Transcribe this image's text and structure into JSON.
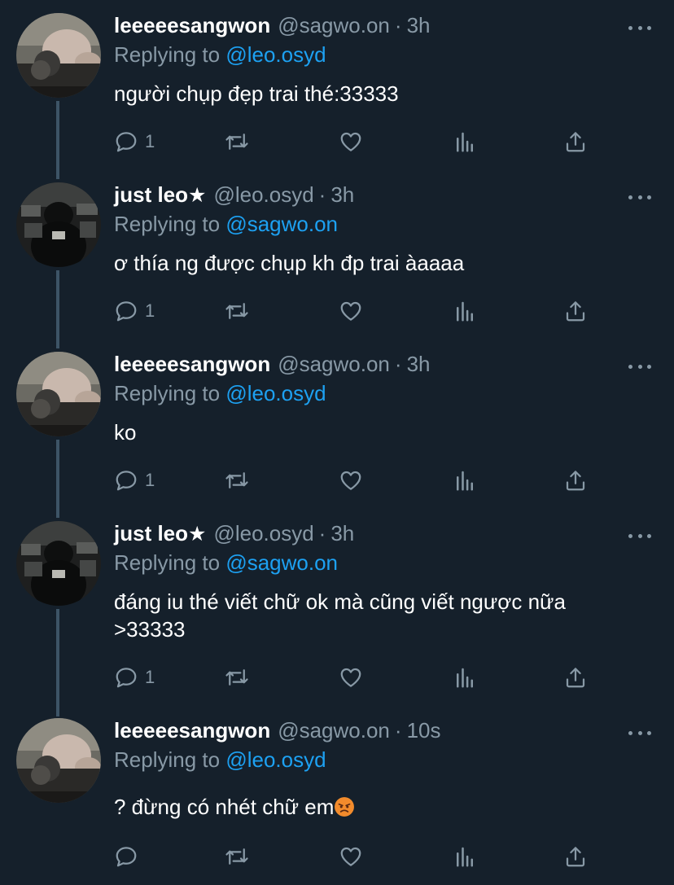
{
  "tweets": [
    {
      "name": "leeeeesangwon",
      "star": "",
      "handle": "@sagwo.on",
      "dot": "·",
      "time": "3h",
      "replying_prefix": "Replying to",
      "replying_to": "@leo.osyd",
      "text": "người chụp đẹp trai thé:33333",
      "reply_count": "1",
      "avatar": "avatar-sangwon"
    },
    {
      "name": "just leo",
      "star": "★",
      "handle": "@leo.osyd",
      "dot": "·",
      "time": "3h",
      "replying_prefix": "Replying to",
      "replying_to": "@sagwo.on",
      "text": "ơ thía ng được chụp kh đp trai àaaaa",
      "reply_count": "1",
      "avatar": "avatar-leo"
    },
    {
      "name": "leeeeesangwon",
      "star": "",
      "handle": "@sagwo.on",
      "dot": "·",
      "time": "3h",
      "replying_prefix": "Replying to",
      "replying_to": "@leo.osyd",
      "text": "ko",
      "reply_count": "1",
      "avatar": "avatar-sangwon"
    },
    {
      "name": "just leo",
      "star": "★",
      "handle": "@leo.osyd",
      "dot": "·",
      "time": "3h",
      "replying_prefix": "Replying to",
      "replying_to": "@sagwo.on",
      "text": "đáng iu thé viết chữ ok mà cũng viết ngược nữa >33333",
      "reply_count": "1",
      "avatar": "avatar-leo"
    },
    {
      "name": "leeeeesangwon",
      "star": "",
      "handle": "@sagwo.on",
      "dot": "·",
      "time": "10s",
      "replying_prefix": "Replying to",
      "replying_to": "@leo.osyd",
      "text": "? đừng có nhét chữ em",
      "emoji": "angry-face-emoji",
      "reply_count": "",
      "avatar": "avatar-sangwon"
    }
  ],
  "icons": {
    "reply": "reply-icon",
    "retweet": "retweet-icon",
    "like": "heart-icon",
    "stats": "analytics-icon",
    "share": "share-icon",
    "more": "more-icon"
  },
  "colors": {
    "background": "#15202b",
    "secondary_text": "#8899a6",
    "accent": "#1da1f2",
    "thread_line": "#3d5466"
  }
}
